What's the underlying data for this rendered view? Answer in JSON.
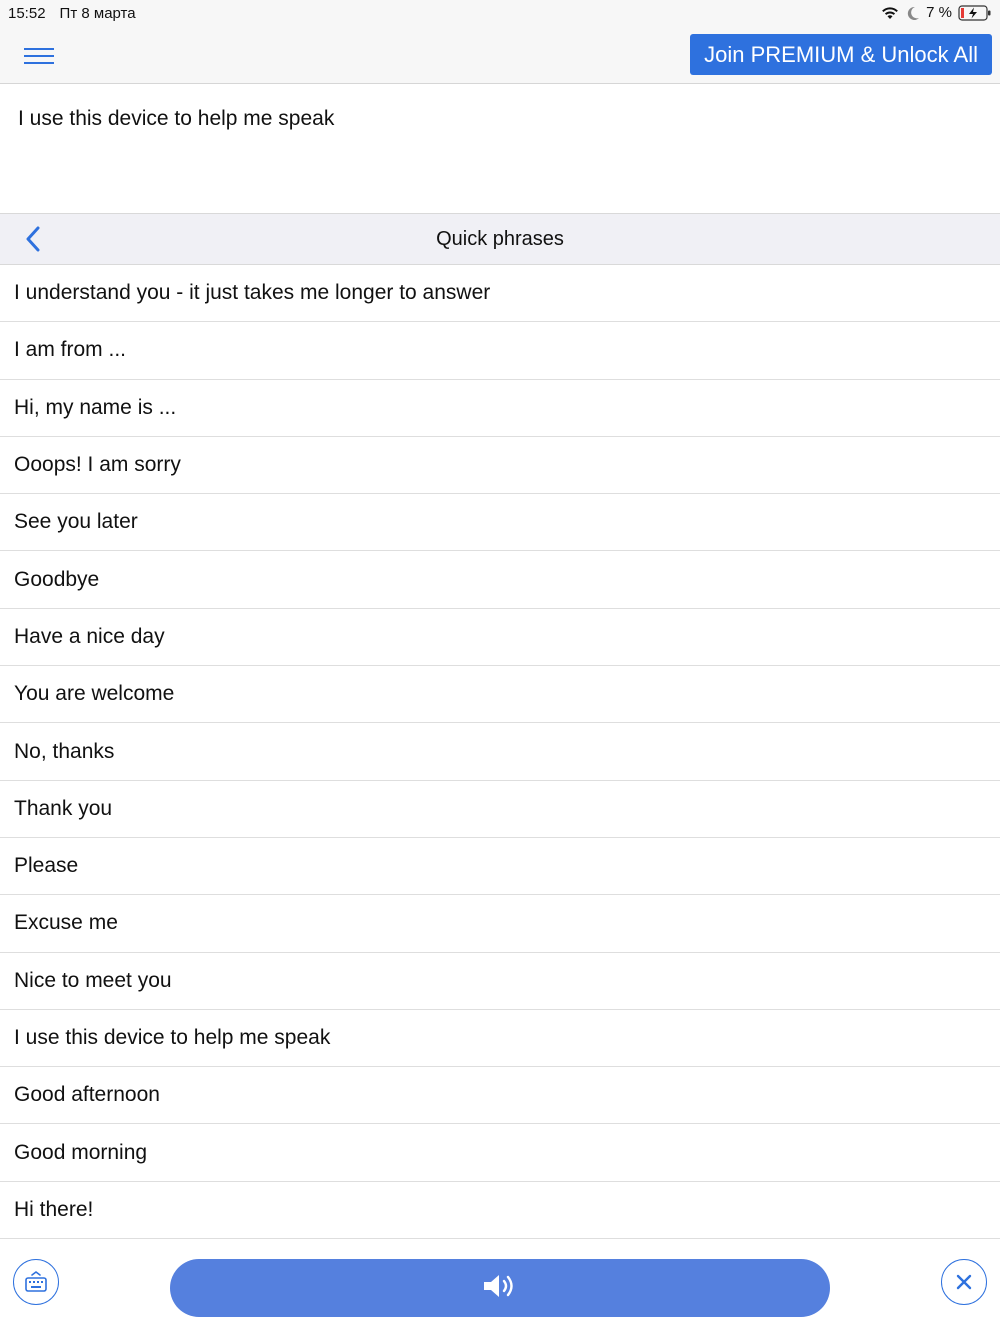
{
  "status_bar": {
    "time": "15:52",
    "date": "Пт 8 марта",
    "battery_percent": "7 %",
    "icons": [
      "wifi-icon",
      "moon-icon",
      "battery-charging-icon"
    ]
  },
  "header": {
    "menu_icon": "hamburger-menu-icon",
    "premium_label": "Join PREMIUM & Unlock All"
  },
  "speech_text": "I use this device to help me speak",
  "section": {
    "title": "Quick phrases",
    "back_icon": "chevron-left-icon"
  },
  "phrases": [
    "I understand you - it just takes me longer to answer",
    "I am from ...",
    "Hi, my name is ...",
    "Ooops! I am sorry",
    "See you later",
    "Goodbye",
    "Have a nice day",
    "You are welcome",
    "No, thanks",
    "Thank you",
    "Please",
    "Excuse me",
    "Nice to meet you",
    "I use this device to help me speak",
    "Good afternoon",
    "Good morning",
    "Hi there!"
  ],
  "bottom_bar": {
    "keyboard_icon": "keyboard-icon",
    "speak_icon": "speaker-icon",
    "close_icon": "close-icon"
  },
  "colors": {
    "accent": "#2e71de",
    "speak_button": "#5580de",
    "battery_low": "#e53935"
  }
}
